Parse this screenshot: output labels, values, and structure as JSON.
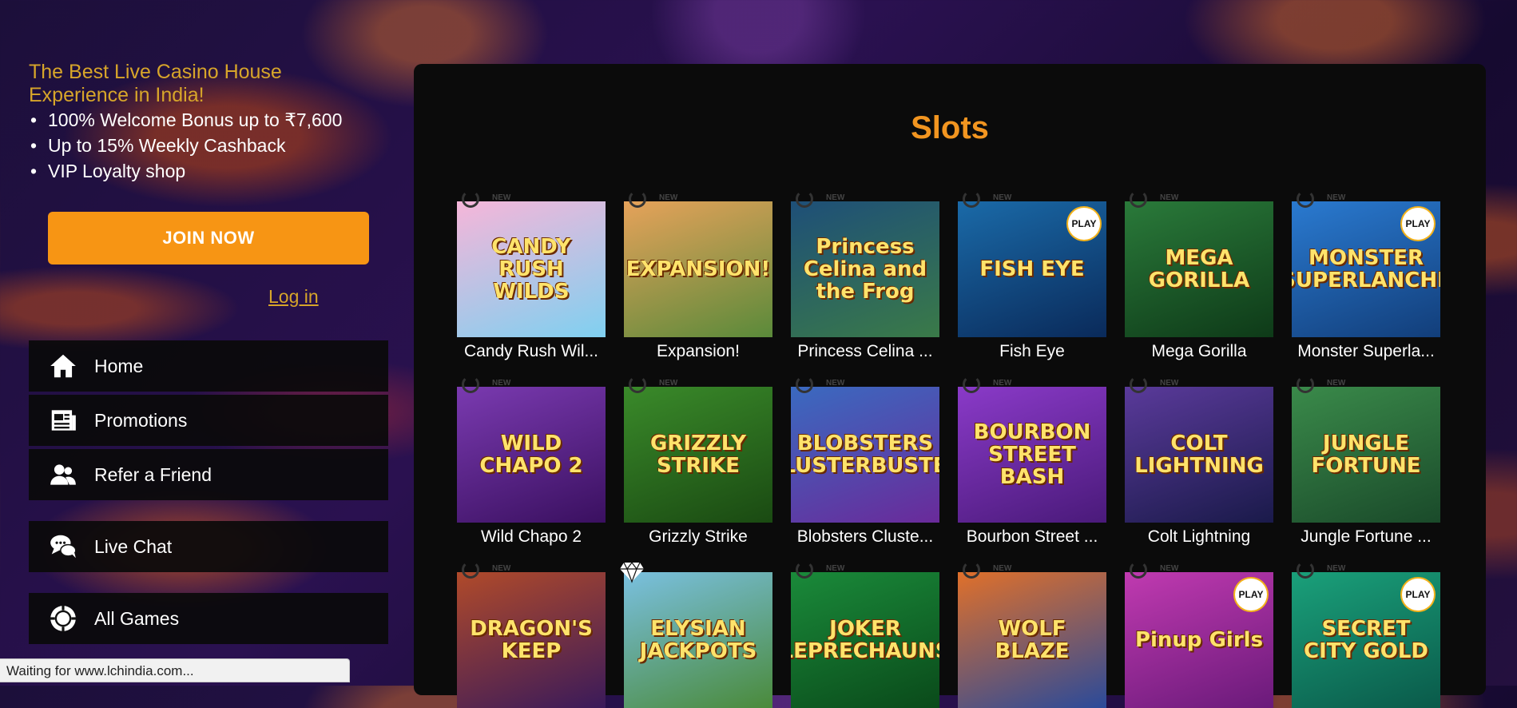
{
  "promo": {
    "title": "The Best Live Casino House Experience in India!",
    "bullets": [
      "100% Welcome Bonus up to ₹7,600",
      "Up to 15% Weekly Cashback",
      "VIP Loyalty shop"
    ],
    "join_label": "JOIN NOW",
    "login_label": "Log in"
  },
  "nav": [
    {
      "label": "Home",
      "icon": "home-icon"
    },
    {
      "label": "Promotions",
      "icon": "news-icon"
    },
    {
      "label": "Refer a Friend",
      "icon": "users-icon"
    },
    {
      "label": "Live Chat",
      "icon": "chat-icon"
    },
    {
      "label": "All Games",
      "icon": "chip-icon"
    }
  ],
  "status_bar": "Waiting for www.lchindia.com...",
  "section": {
    "title": "Slots",
    "rows": [
      [
        {
          "label": "Candy Rush Wil...",
          "art": "CANDY RUSH WILDS",
          "colors": [
            "#f6b6d9",
            "#7fd0f0"
          ],
          "badge": "new",
          "play": false
        },
        {
          "label": "Expansion!",
          "art": "EXPANSION!",
          "colors": [
            "#e6a25a",
            "#5a8a3a"
          ],
          "badge": "new",
          "play": false
        },
        {
          "label": "Princess Celina ...",
          "art": "Princess Celina and the Frog",
          "colors": [
            "#1e4f78",
            "#3a7a48"
          ],
          "badge": "new",
          "play": false
        },
        {
          "label": "Fish Eye",
          "art": "FISH EYE",
          "colors": [
            "#1a6aa8",
            "#0a2a5a"
          ],
          "badge": "new",
          "play": true
        },
        {
          "label": "Mega Gorilla",
          "art": "MEGA GORILLA",
          "colors": [
            "#2a7a3a",
            "#0e3a18"
          ],
          "badge": "new",
          "play": false
        },
        {
          "label": "Monster Superla...",
          "art": "MONSTER SUPERLANCHE",
          "colors": [
            "#2a7ad0",
            "#123e7a"
          ],
          "badge": "new",
          "play": true
        }
      ],
      [
        {
          "label": "Wild Chapo 2",
          "art": "WILD CHAPO 2",
          "colors": [
            "#7a3ab0",
            "#3a1060"
          ],
          "badge": "new",
          "play": false
        },
        {
          "label": "Grizzly Strike",
          "art": "GRIZZLY STRIKE",
          "colors": [
            "#3a8a2a",
            "#1a4a12"
          ],
          "badge": "new",
          "play": false
        },
        {
          "label": "Blobsters Cluste...",
          "art": "BLOBSTERS CLUSTERBUSTER",
          "colors": [
            "#3a6ac0",
            "#6a2a9a"
          ],
          "badge": "new",
          "play": false
        },
        {
          "label": "Bourbon Street ...",
          "art": "BOURBON STREET BASH",
          "colors": [
            "#8a3ac8",
            "#4a1a7a"
          ],
          "badge": "new",
          "play": false
        },
        {
          "label": "Colt Lightning",
          "art": "COLT LIGHTNING",
          "colors": [
            "#5a3a9a",
            "#1a1a4a"
          ],
          "badge": "new",
          "play": false
        },
        {
          "label": "Jungle Fortune ...",
          "art": "JUNGLE FORTUNE",
          "colors": [
            "#3a8a4a",
            "#1a4a2a"
          ],
          "badge": "new",
          "play": false
        }
      ],
      [
        {
          "label": "",
          "art": "DRAGON'S KEEP",
          "colors": [
            "#b04a2a",
            "#3a1a5a"
          ],
          "badge": "new",
          "play": false
        },
        {
          "label": "",
          "art": "ELYSIAN JACKPOTS",
          "colors": [
            "#7ac0e0",
            "#4a8a3a"
          ],
          "badge": "gem",
          "play": false
        },
        {
          "label": "",
          "art": "JOKER LEPRECHAUNS",
          "colors": [
            "#1a8a3a",
            "#0a4a1a"
          ],
          "badge": "new",
          "play": false
        },
        {
          "label": "",
          "art": "WOLF BLAZE",
          "colors": [
            "#e0702a",
            "#2a4a9a"
          ],
          "badge": "new",
          "play": false
        },
        {
          "label": "",
          "art": "Pinup Girls",
          "colors": [
            "#c03ab0",
            "#6a1a7a"
          ],
          "badge": "new",
          "play": true
        },
        {
          "label": "",
          "art": "SECRET CITY GOLD",
          "colors": [
            "#1aa07a",
            "#0a5a4a"
          ],
          "badge": "new",
          "play": true
        }
      ]
    ]
  },
  "badge_text": "NEW",
  "play_text": "PLAY"
}
